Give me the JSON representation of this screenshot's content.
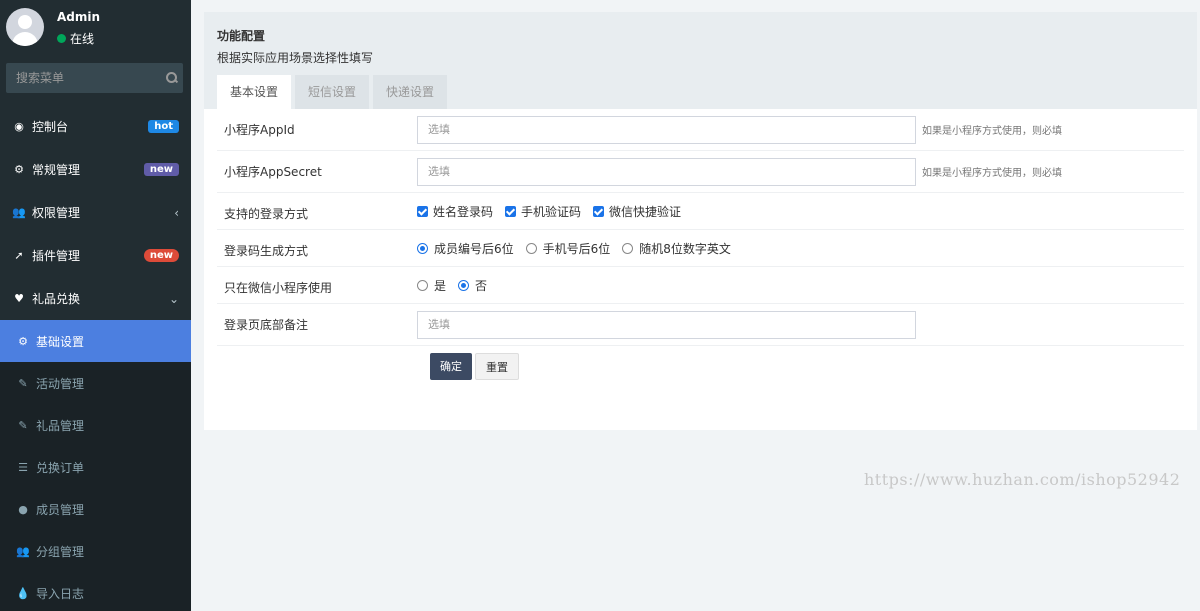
{
  "user": {
    "name": "Admin",
    "status": "在线"
  },
  "search": {
    "placeholder": "搜索菜单"
  },
  "menu": [
    {
      "label": "控制台",
      "icon": "dashboard-icon",
      "badge": "hot"
    },
    {
      "label": "常规管理",
      "icon": "cogs-icon",
      "badge": "new"
    },
    {
      "label": "权限管理",
      "icon": "users-icon",
      "chevron": "‹"
    },
    {
      "label": "插件管理",
      "icon": "rocket-icon",
      "badge": "new"
    },
    {
      "label": "礼品兑换",
      "icon": "heart-icon",
      "chevron": "⌄"
    }
  ],
  "submenu": [
    {
      "label": "基础设置",
      "icon": "cogs-icon",
      "active": true
    },
    {
      "label": "活动管理",
      "icon": "leaf-icon"
    },
    {
      "label": "礼品管理",
      "icon": "leaf-icon"
    },
    {
      "label": "兑换订单",
      "icon": "list-icon"
    },
    {
      "label": "成员管理",
      "icon": "user-icon"
    },
    {
      "label": "分组管理",
      "icon": "users-icon"
    },
    {
      "label": "导入日志",
      "icon": "drop-icon"
    }
  ],
  "panel": {
    "title": "功能配置",
    "subtitle": "根据实际应用场景选择性填写",
    "tabs": [
      "基本设置",
      "短信设置",
      "快递设置"
    ]
  },
  "form": {
    "appid": {
      "label": "小程序AppId",
      "placeholder": "选填",
      "hint": "如果是小程序方式使用，则必填"
    },
    "appsecret": {
      "label": "小程序AppSecret",
      "placeholder": "选填",
      "hint": "如果是小程序方式使用，则必填"
    },
    "login_methods": {
      "label": "支持的登录方式",
      "options": [
        "姓名登录码",
        "手机验证码",
        "微信快捷验证"
      ]
    },
    "code_gen": {
      "label": "登录码生成方式",
      "options": [
        "成员编号后6位",
        "手机号后6位",
        "随机8位数字英文"
      ]
    },
    "wechat_only": {
      "label": "只在微信小程序使用",
      "options": [
        "是",
        "否"
      ]
    },
    "footer_note": {
      "label": "登录页底部备注",
      "placeholder": "选填"
    },
    "submit": "确定",
    "reset": "重置"
  },
  "watermark": "https://www.huzhan.com/ishop52942"
}
